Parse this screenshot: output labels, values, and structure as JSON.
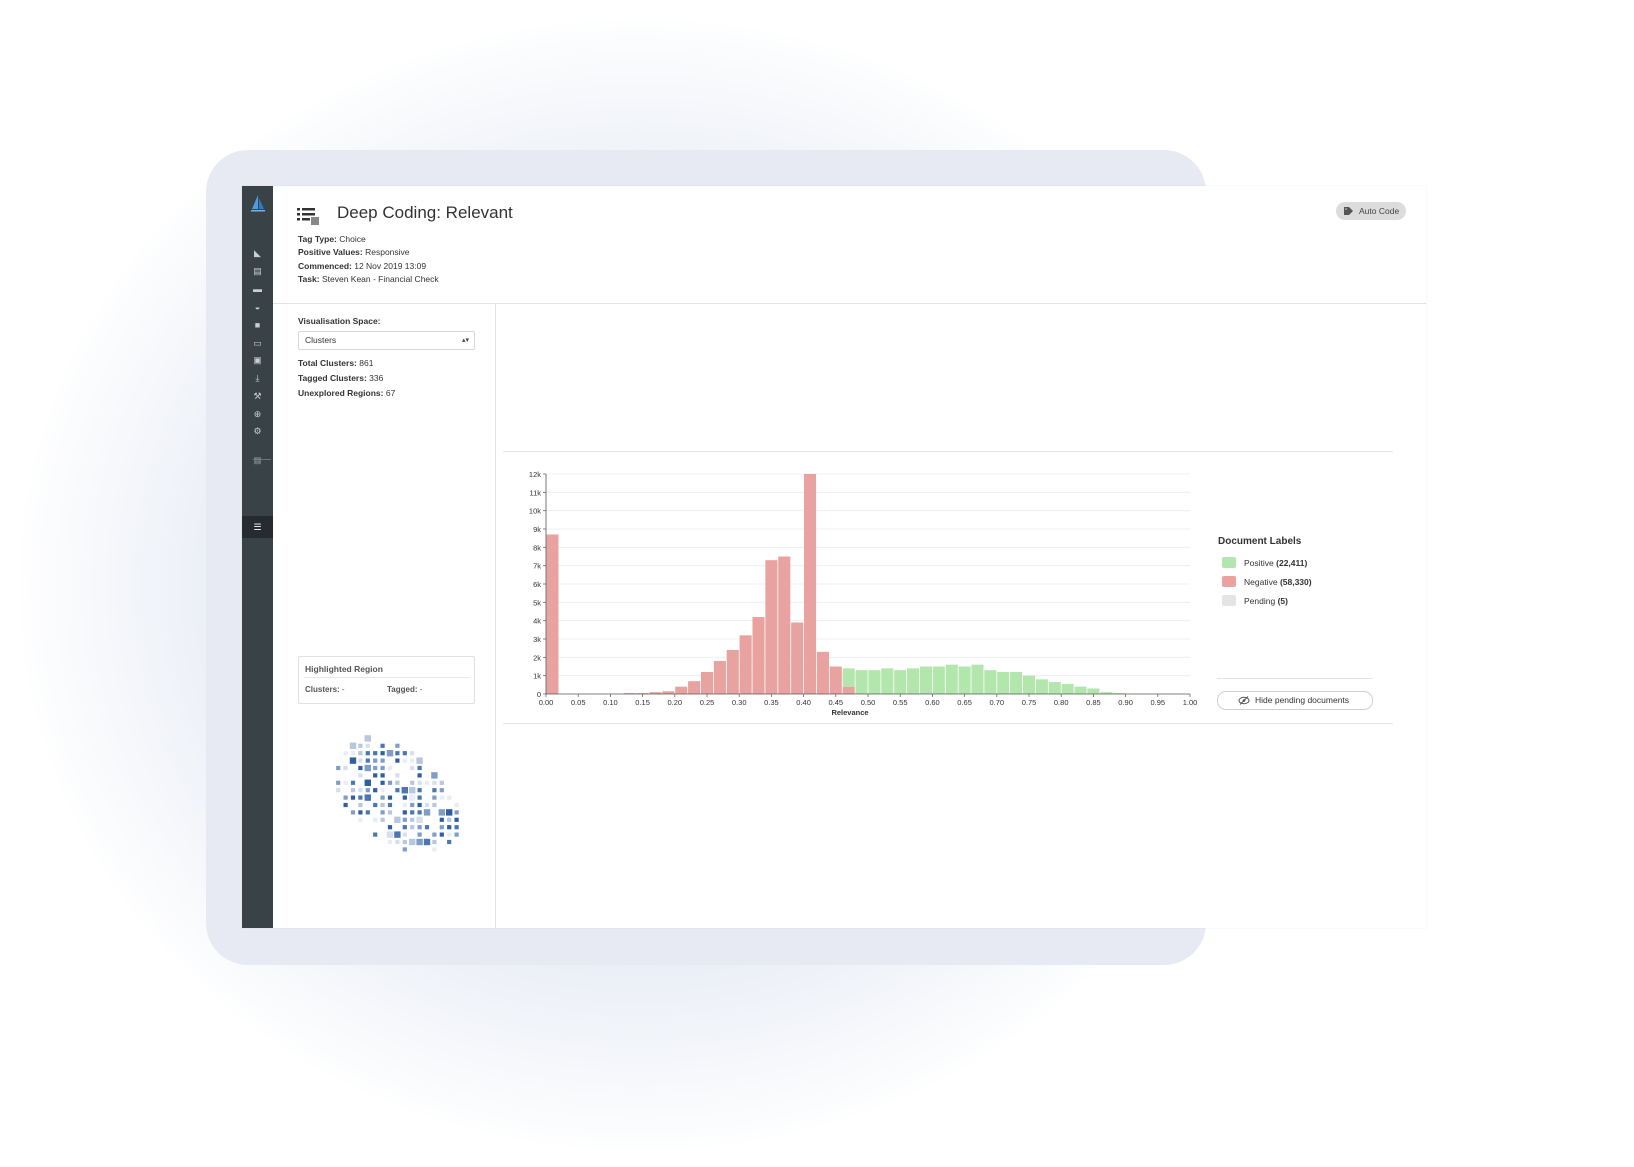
{
  "header": {
    "title": "Deep Coding: Relevant",
    "auto_code_label": "Auto Code",
    "meta": [
      {
        "key": "Tag Type:",
        "value": "Choice"
      },
      {
        "key": "Positive Values:",
        "value": "Responsive"
      },
      {
        "key": "Commenced:",
        "value": "12 Nov 2019 13:09"
      },
      {
        "key": "Task:",
        "value": "Steven Kean - Financial Check"
      }
    ]
  },
  "sidebar_icons": [
    "cursor-icon",
    "archive-icon",
    "folder-icon",
    "dashboard-icon",
    "document-icon",
    "review-icon",
    "briefcase-icon",
    "download-icon",
    "wrench-icon",
    "search-icon",
    "gear-icon",
    "grid-icon",
    "task-list-icon"
  ],
  "left_panel": {
    "visualisation_label": "Visualisation Space:",
    "visualisation_value": "Clusters",
    "stats": [
      {
        "key": "Total Clusters:",
        "value": "861"
      },
      {
        "key": "Tagged Clusters:",
        "value": "336"
      },
      {
        "key": "Unexplored Regions:",
        "value": "67"
      }
    ],
    "highlighted_region": {
      "title": "Highlighted Region",
      "clusters_label": "Clusters:",
      "clusters_value": "-",
      "tagged_label": "Tagged:",
      "tagged_value": "-"
    }
  },
  "legend": {
    "title": "Document Labels",
    "items": [
      {
        "name": "Positive",
        "count": "(22,411)",
        "color": "#b3e6ad"
      },
      {
        "name": "Negative",
        "count": "(58,330)",
        "color": "#e8a3a0"
      },
      {
        "name": "Pending",
        "count": "(5)",
        "color": "#e4e4e4"
      }
    ],
    "hide_pending_label": "Hide pending documents"
  },
  "chart_data": {
    "type": "bar",
    "xlabel": "Relevance",
    "ylabel": "",
    "xlim": [
      0,
      1
    ],
    "ylim": [
      0,
      12000
    ],
    "x_ticks": [
      "0.00",
      "0.05",
      "0.10",
      "0.15",
      "0.20",
      "0.25",
      "0.30",
      "0.35",
      "0.40",
      "0.45",
      "0.50",
      "0.55",
      "0.60",
      "0.65",
      "0.70",
      "0.75",
      "0.80",
      "0.85",
      "0.90",
      "0.95",
      "1.00"
    ],
    "y_ticks": [
      "0",
      "1k",
      "2k",
      "3k",
      "4k",
      "5k",
      "6k",
      "7k",
      "8k",
      "9k",
      "10k",
      "11k",
      "12k"
    ],
    "bin_width": 0.02,
    "series": [
      {
        "name": "Negative",
        "color": "#e8a3a0",
        "values": [
          8700,
          0,
          0,
          0,
          0,
          0,
          50,
          50,
          100,
          150,
          400,
          700,
          1200,
          1800,
          2400,
          3200,
          4200,
          7300,
          7500,
          3900,
          12000,
          2300,
          1500,
          400,
          0,
          0,
          0,
          0,
          0,
          0,
          0,
          0,
          0,
          0,
          0,
          0,
          0,
          0,
          0,
          0,
          0,
          0,
          0,
          0,
          0,
          0,
          0,
          0,
          0,
          0
        ]
      },
      {
        "name": "Positive",
        "color": "#b3e6ad",
        "values": [
          0,
          0,
          0,
          0,
          0,
          0,
          0,
          0,
          0,
          0,
          0,
          0,
          0,
          0,
          0,
          0,
          0,
          0,
          0,
          0,
          0,
          0,
          0,
          1000,
          1300,
          1300,
          1400,
          1300,
          1400,
          1500,
          1500,
          1600,
          1500,
          1600,
          1300,
          1200,
          1200,
          1000,
          800,
          650,
          550,
          400,
          300,
          100,
          50,
          0,
          0,
          0,
          0,
          0
        ]
      }
    ]
  }
}
